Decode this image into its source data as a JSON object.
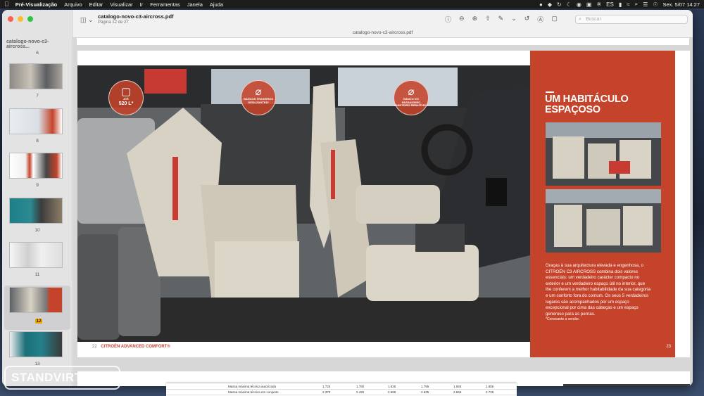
{
  "menubar": {
    "app": "Pré-Visualização",
    "items": [
      "Arquivo",
      "Editar",
      "Visualizar",
      "Ir",
      "Ferramentas",
      "Janela",
      "Ajuda"
    ],
    "clock": "Sex. 5/07  14:27",
    "lang": "ES"
  },
  "toolbar": {
    "filename": "catalogo-novo-c3-aircross.pdf",
    "page_info": "Página 12 de 27",
    "doc_title": "catalogo-novo-c3-aircross.pdf",
    "search_placeholder": "Buscar"
  },
  "sidebar": {
    "title": "catalogo-novo-c3-aircross...",
    "thumbnails": [
      {
        "num": "6"
      },
      {
        "num": "7"
      },
      {
        "num": "8"
      },
      {
        "num": "9"
      },
      {
        "num": "10"
      },
      {
        "num": "11"
      },
      {
        "num": "12",
        "selected": true
      },
      {
        "num": "13"
      }
    ]
  },
  "page_left": {
    "footer_num": "22",
    "footer_brand": "CITROËN ADVANCED COMFORT®",
    "badges": [
      {
        "line1": "ATÉ",
        "line2": "520 L*"
      },
      {
        "line1": "BANCOS TRASEIROS",
        "line2": "DESLIZANTES*"
      },
      {
        "line1": "BANCO DO PASSAGEIRO",
        "line2": "DIANTEIRO REBATÍVEL*"
      }
    ]
  },
  "page_right": {
    "title_line1": "UM HABITÁCULO",
    "title_line2": "ESPAÇOSO",
    "body": "Graças à sua arquitectura elevada e engenhosa, o CITROËN C3 AIRCROSS combina dois valores essenciais: um verdadeiro carácter compacto no exterior e um verdadeiro espaço útil no interior, que lhe conferem a melhor habitabilidade da sua categoria e um conforto fora do comum. Os seus 5 verdadeiros lugares são acompanhados por um espaço excepcional por cima das cabeças e um espaço generoso para as pernas.",
    "note": "*Consoante a versão.",
    "page_num": "23"
  },
  "spec_table": {
    "rows": [
      {
        "label": "Massa máxima técnica autorizada",
        "values": [
          "1.720",
          "1.780",
          "1.825",
          "1.795",
          "1.825",
          "1.855"
        ]
      },
      {
        "label": "Massa máxima técnica em conjunto",
        "values": [
          "2.370",
          "2.420",
          "2.665",
          "2.635",
          "2.665",
          "2.725"
        ]
      }
    ]
  },
  "watermark": "STANDVIRTUAL",
  "colors": {
    "accent": "#c4432a",
    "menubar": "#1e1e1e"
  }
}
